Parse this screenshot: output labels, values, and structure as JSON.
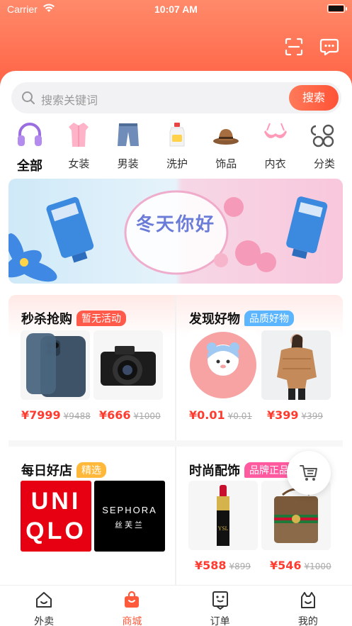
{
  "status_bar": {
    "carrier": "Carrier",
    "time": "10:07 AM"
  },
  "search": {
    "placeholder": "搜索关键词",
    "button": "搜索"
  },
  "categories": [
    {
      "label": "全部",
      "icon": "headphones-icon",
      "active": true
    },
    {
      "label": "女装",
      "icon": "womens-shirt-icon"
    },
    {
      "label": "男装",
      "icon": "jeans-icon"
    },
    {
      "label": "洗护",
      "icon": "detergent-bottle-icon"
    },
    {
      "label": "饰品",
      "icon": "hat-icon"
    },
    {
      "label": "内衣",
      "icon": "bra-icon"
    },
    {
      "label": "分类",
      "icon": "grid-icon"
    }
  ],
  "banner": {
    "title": "冬天你好"
  },
  "sections": {
    "flash_sale": {
      "title": "秒杀抢购",
      "tag": "暂无活动",
      "tag_color": "#ff5a4a",
      "products": [
        {
          "name": "iphone-product-image",
          "price": "¥7999",
          "original": "¥9488"
        },
        {
          "name": "camera-product-image",
          "price": "¥666",
          "original": "¥1000"
        }
      ]
    },
    "discover": {
      "title": "发现好物",
      "tag": "品质好物",
      "tag_color": "#5bb6ff",
      "products": [
        {
          "name": "roroco-bear-image",
          "price": "¥0.01",
          "original": "¥0.01"
        },
        {
          "name": "puffer-jacket-image",
          "price": "¥399",
          "original": "¥399"
        }
      ]
    },
    "daily_store": {
      "title": "每日好店",
      "tag": "精选",
      "tag_color": "#ffb83a",
      "brands": [
        {
          "line1": "UNI",
          "line2": "QLO"
        },
        {
          "line1": "SEPHORA",
          "line2": "丝芙兰"
        }
      ]
    },
    "fashion": {
      "title": "时尚配饰",
      "tag": "品牌正品",
      "tag_color": "#ff5aa0",
      "products": [
        {
          "name": "lipstick-image",
          "price": "¥588",
          "original": "¥899"
        },
        {
          "name": "gucci-bag-image",
          "price": "¥546",
          "original": "¥1000"
        }
      ]
    }
  },
  "tabbar": [
    {
      "label": "外卖",
      "icon": "home-icon"
    },
    {
      "label": "商城",
      "icon": "shopping-bag-icon",
      "active": true
    },
    {
      "label": "订单",
      "icon": "order-icon"
    },
    {
      "label": "我的",
      "icon": "profile-icon"
    }
  ],
  "colors": {
    "accent": "#ff5a3c",
    "price": "#ff3b30"
  }
}
